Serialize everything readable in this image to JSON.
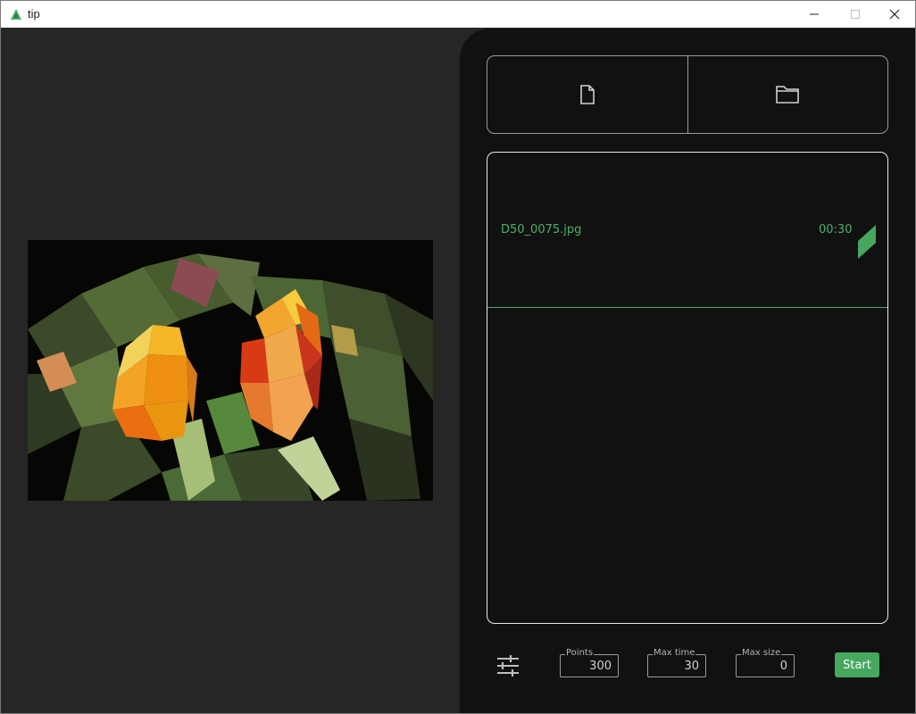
{
  "window": {
    "title": "tip",
    "controls": [
      "minimize",
      "maximize",
      "close"
    ]
  },
  "preview": {
    "image_description": "low-poly rendering of two tulips",
    "icon": "image-preview"
  },
  "open_buttons": [
    {
      "icon": "file-icon"
    },
    {
      "icon": "folder-icon"
    }
  ],
  "files": [
    {
      "name": "D50_0075.jpg",
      "time": "00:30",
      "progress": 1.0
    }
  ],
  "settings": {
    "icon": "sliders-icon",
    "points_label": "Points",
    "points_value": "300",
    "max_time_label": "Max time",
    "max_time_value": "30",
    "max_size_label": "Max size",
    "max_size_value": "0",
    "start_label": "Start"
  },
  "colors": {
    "accent": "#45a85e",
    "panel": "#111111",
    "background": "#262626"
  }
}
